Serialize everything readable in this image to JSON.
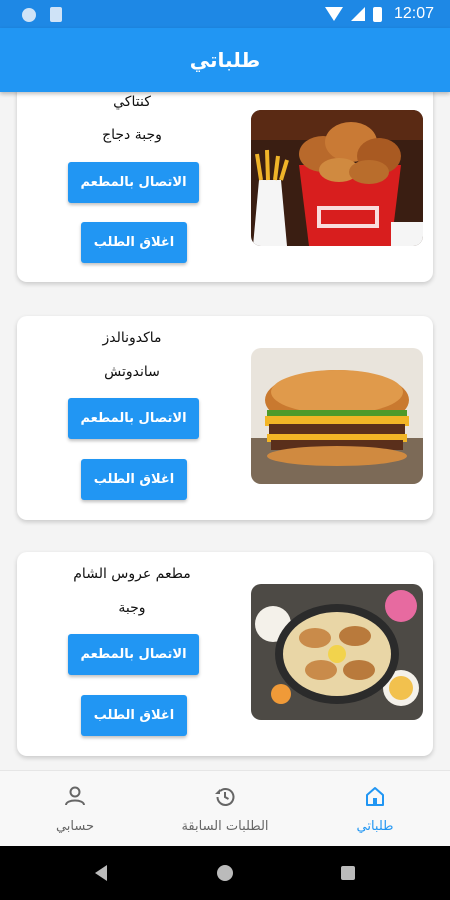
{
  "status_bar": {
    "time": "12:07"
  },
  "app_bar": {
    "title": "طلباتي"
  },
  "orders": [
    {
      "restaurant": "كنتاكي",
      "meal": "وجبة دجاج",
      "image": "fried-chicken-bucket",
      "call_label": "الاتصال بالمطعم",
      "close_label": "اغلاق الطلب"
    },
    {
      "restaurant": "ماكدونالدز",
      "meal": "ساندوتش",
      "image": "burger",
      "call_label": "الاتصال بالمطعم",
      "close_label": "اغلاق الطلب"
    },
    {
      "restaurant": "مطعم عروس الشام",
      "meal": "وجبة",
      "image": "shawarma-platter",
      "call_label": "الاتصال بالمطعم",
      "close_label": "اغلاق الطلب"
    }
  ],
  "bottom_nav": {
    "items": [
      {
        "label": "حسابي",
        "icon": "person-icon"
      },
      {
        "label": "الطلبات السابقة",
        "icon": "history-icon"
      },
      {
        "label": "طلباتي",
        "icon": "home-icon",
        "active": true
      }
    ]
  },
  "colors": {
    "primary": "#2196f3",
    "status_bar": "#1e88e5"
  }
}
